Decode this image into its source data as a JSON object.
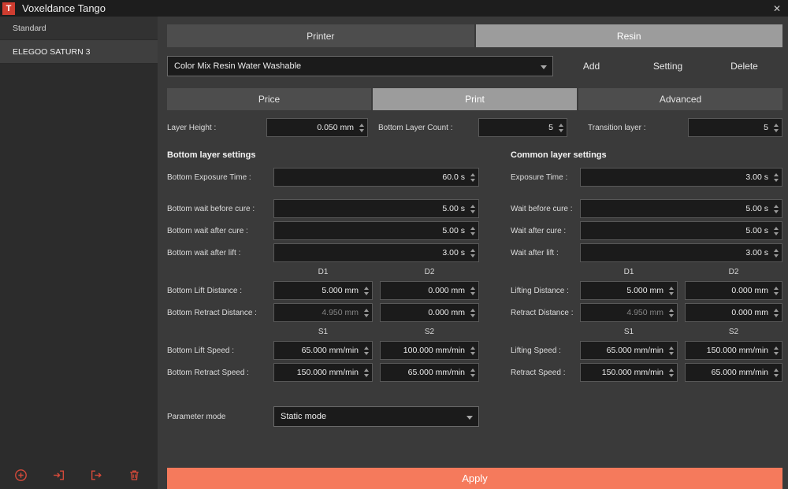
{
  "titlebar": {
    "title": "Voxeldance Tango",
    "close": "✕"
  },
  "sidebar": {
    "items": [
      {
        "label": "Standard"
      },
      {
        "label": "ELEGOO SATURN 3"
      }
    ]
  },
  "printer_resin_tabs": [
    {
      "label": "Printer"
    },
    {
      "label": "Resin"
    }
  ],
  "resin_row": {
    "selected_resin": "Color Mix Resin Water Washable",
    "add_label": "Add",
    "setting_label": "Setting",
    "delete_label": "Delete"
  },
  "section_tabs": [
    {
      "label": "Price"
    },
    {
      "label": "Print"
    },
    {
      "label": "Advanced"
    }
  ],
  "general_row": {
    "layer_height": {
      "label": "Layer Height :",
      "value": "0.050 mm"
    },
    "bottom_layer_count": {
      "label": "Bottom Layer Count :",
      "value": "5"
    },
    "transition_layer": {
      "label": "Transition layer :",
      "value": "5"
    }
  },
  "bottom": {
    "title": "Bottom layer settings",
    "exposure_label": "Bottom Exposure Time :",
    "exposure_value": "60.0 s",
    "wait_rows": [
      {
        "label": "Bottom wait before cure :",
        "value": "5.00 s"
      },
      {
        "label": "Bottom wait after cure :",
        "value": "5.00 s"
      },
      {
        "label": "Bottom wait after lift :",
        "value": "3.00 s"
      }
    ],
    "d1": "D1",
    "d2": "D2",
    "lift_distance": {
      "label": "Bottom Lift Distance :",
      "v1": "5.000 mm",
      "v2": "0.000 mm"
    },
    "retract_distance": {
      "label": "Bottom Retract Distance :",
      "v1": "4.950 mm",
      "v2": "0.000 mm"
    },
    "s1": "S1",
    "s2": "S2",
    "lift_speed": {
      "label": "Bottom Lift Speed :",
      "v1": "65.000 mm/min",
      "v2": "100.000 mm/min"
    },
    "retract_speed": {
      "label": "Bottom Retract Speed :",
      "v1": "150.000 mm/min",
      "v2": "65.000 mm/min"
    }
  },
  "common": {
    "title": "Common layer settings",
    "exposure_label": "Exposure Time :",
    "exposure_value": "3.00 s",
    "wait_rows": [
      {
        "label": "Wait before cure :",
        "value": "5.00 s"
      },
      {
        "label": "Wait after cure :",
        "value": "5.00 s"
      },
      {
        "label": "Wait after lift :",
        "value": "3.00 s"
      }
    ],
    "d1": "D1",
    "d2": "D2",
    "lift_distance": {
      "label": "Lifting Distance :",
      "v1": "5.000 mm",
      "v2": "0.000 mm"
    },
    "retract_distance": {
      "label": "Retract Distance :",
      "v1": "4.950 mm",
      "v2": "0.000 mm"
    },
    "s1": "S1",
    "s2": "S2",
    "lift_speed": {
      "label": "Lifting Speed :",
      "v1": "65.000 mm/min",
      "v2": "150.000 mm/min"
    },
    "retract_speed": {
      "label": "Retract Speed :",
      "v1": "150.000 mm/min",
      "v2": "65.000 mm/min"
    }
  },
  "parameter_mode": {
    "label": "Parameter mode",
    "value": "Static mode"
  },
  "apply": {
    "label": "Apply"
  },
  "colors": {
    "accent": "#f57a5c",
    "danger_icon": "#d64a3a",
    "selected_tab": "#9c9c9c"
  }
}
